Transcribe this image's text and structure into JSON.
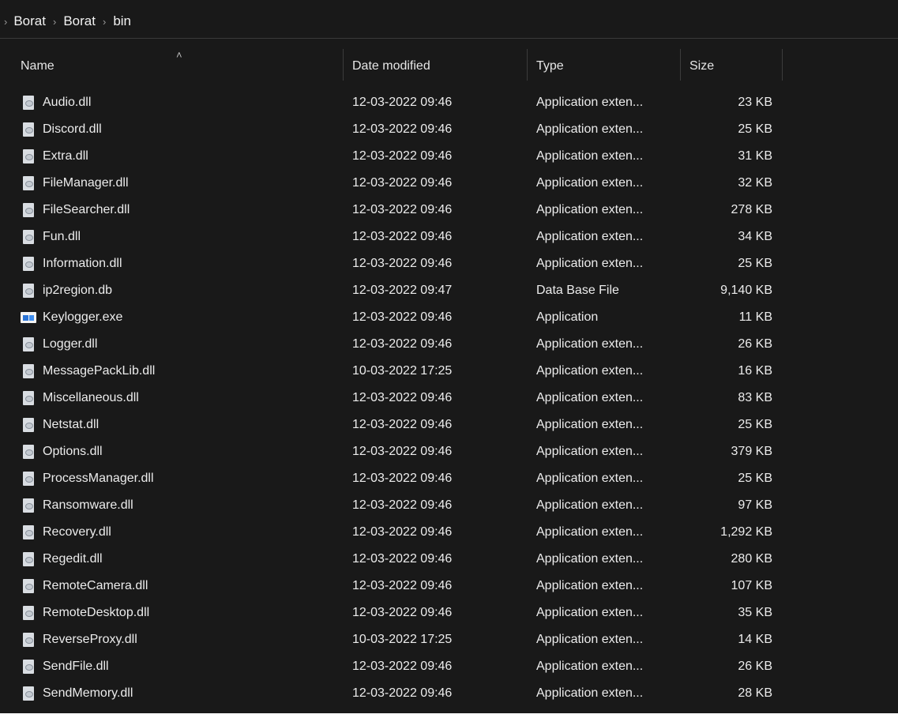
{
  "breadcrumb": [
    "Borat",
    "Borat",
    "bin"
  ],
  "columns": {
    "name": "Name",
    "date": "Date modified",
    "type": "Type",
    "size": "Size"
  },
  "sort": {
    "column": "Name",
    "indicator": "up-chevron-icon"
  },
  "colors": {
    "background": "#191919",
    "text": "#ececec",
    "divider": "#3a3a3a"
  },
  "files": [
    {
      "name": "Audio.dll",
      "date": "12-03-2022 09:46",
      "type": "Application exten...",
      "size": "23 KB",
      "icon": "dll-file-icon"
    },
    {
      "name": "Discord.dll",
      "date": "12-03-2022 09:46",
      "type": "Application exten...",
      "size": "25 KB",
      "icon": "dll-file-icon"
    },
    {
      "name": "Extra.dll",
      "date": "12-03-2022 09:46",
      "type": "Application exten...",
      "size": "31 KB",
      "icon": "dll-file-icon"
    },
    {
      "name": "FileManager.dll",
      "date": "12-03-2022 09:46",
      "type": "Application exten...",
      "size": "32 KB",
      "icon": "dll-file-icon"
    },
    {
      "name": "FileSearcher.dll",
      "date": "12-03-2022 09:46",
      "type": "Application exten...",
      "size": "278 KB",
      "icon": "dll-file-icon"
    },
    {
      "name": "Fun.dll",
      "date": "12-03-2022 09:46",
      "type": "Application exten...",
      "size": "34 KB",
      "icon": "dll-file-icon"
    },
    {
      "name": "Information.dll",
      "date": "12-03-2022 09:46",
      "type": "Application exten...",
      "size": "25 KB",
      "icon": "dll-file-icon"
    },
    {
      "name": "ip2region.db",
      "date": "12-03-2022 09:47",
      "type": "Data Base File",
      "size": "9,140 KB",
      "icon": "db-file-icon"
    },
    {
      "name": "Keylogger.exe",
      "date": "12-03-2022 09:46",
      "type": "Application",
      "size": "11 KB",
      "icon": "exe-file-icon"
    },
    {
      "name": "Logger.dll",
      "date": "12-03-2022 09:46",
      "type": "Application exten...",
      "size": "26 KB",
      "icon": "dll-file-icon"
    },
    {
      "name": "MessagePackLib.dll",
      "date": "10-03-2022 17:25",
      "type": "Application exten...",
      "size": "16 KB",
      "icon": "dll-file-icon"
    },
    {
      "name": "Miscellaneous.dll",
      "date": "12-03-2022 09:46",
      "type": "Application exten...",
      "size": "83 KB",
      "icon": "dll-file-icon"
    },
    {
      "name": "Netstat.dll",
      "date": "12-03-2022 09:46",
      "type": "Application exten...",
      "size": "25 KB",
      "icon": "dll-file-icon"
    },
    {
      "name": "Options.dll",
      "date": "12-03-2022 09:46",
      "type": "Application exten...",
      "size": "379 KB",
      "icon": "dll-file-icon"
    },
    {
      "name": "ProcessManager.dll",
      "date": "12-03-2022 09:46",
      "type": "Application exten...",
      "size": "25 KB",
      "icon": "dll-file-icon"
    },
    {
      "name": "Ransomware.dll",
      "date": "12-03-2022 09:46",
      "type": "Application exten...",
      "size": "97 KB",
      "icon": "dll-file-icon"
    },
    {
      "name": "Recovery.dll",
      "date": "12-03-2022 09:46",
      "type": "Application exten...",
      "size": "1,292 KB",
      "icon": "dll-file-icon"
    },
    {
      "name": "Regedit.dll",
      "date": "12-03-2022 09:46",
      "type": "Application exten...",
      "size": "280 KB",
      "icon": "dll-file-icon"
    },
    {
      "name": "RemoteCamera.dll",
      "date": "12-03-2022 09:46",
      "type": "Application exten...",
      "size": "107 KB",
      "icon": "dll-file-icon"
    },
    {
      "name": "RemoteDesktop.dll",
      "date": "12-03-2022 09:46",
      "type": "Application exten...",
      "size": "35 KB",
      "icon": "dll-file-icon"
    },
    {
      "name": "ReverseProxy.dll",
      "date": "10-03-2022 17:25",
      "type": "Application exten...",
      "size": "14 KB",
      "icon": "dll-file-icon"
    },
    {
      "name": "SendFile.dll",
      "date": "12-03-2022 09:46",
      "type": "Application exten...",
      "size": "26 KB",
      "icon": "dll-file-icon"
    },
    {
      "name": "SendMemory.dll",
      "date": "12-03-2022 09:46",
      "type": "Application exten...",
      "size": "28 KB",
      "icon": "dll-file-icon"
    }
  ]
}
